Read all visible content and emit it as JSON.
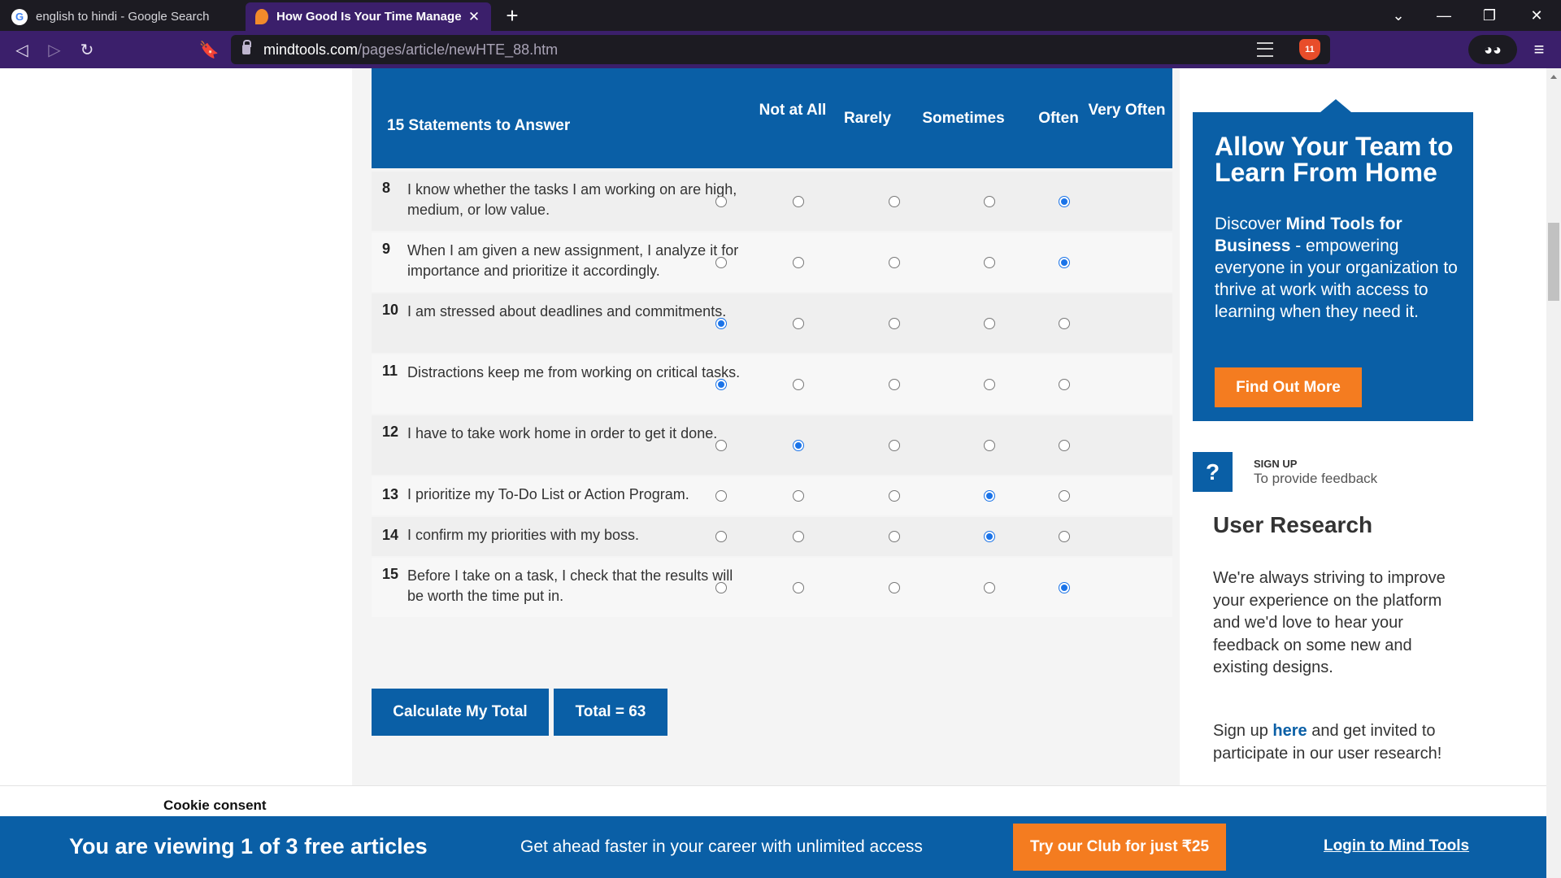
{
  "browser": {
    "tabs": [
      {
        "title": "english to hindi - Google Search",
        "active": false
      },
      {
        "title": "How Good Is Your Time Management",
        "active": true
      }
    ],
    "url_host": "mindtools.com",
    "url_path": "/pages/article/newHTE_88.htm",
    "brave_shield_count": "11"
  },
  "quiz": {
    "header_title": "15 Statements to Answer",
    "columns": [
      "Not at All",
      "Rarely",
      "Sometimes",
      "Often",
      "Very Often"
    ],
    "rows": [
      {
        "num": "8",
        "text": "I know whether the tasks I am working on are high, medium, or low value.",
        "selected": "Very Often"
      },
      {
        "num": "9",
        "text": "When I am given a new assignment, I analyze it for importance and prioritize it accordingly.",
        "selected": "Very Often"
      },
      {
        "num": "10",
        "text": "I am stressed about deadlines and commitments.",
        "selected": "Not at All"
      },
      {
        "num": "11",
        "text": "Distractions keep me from working on critical tasks.",
        "selected": "Not at All"
      },
      {
        "num": "12",
        "text": "I have to take work home in order to get it done.",
        "selected": "Rarely"
      },
      {
        "num": "13",
        "text": "I prioritize my To-Do List or Action Program.",
        "selected": "Often"
      },
      {
        "num": "14",
        "text": "I confirm my priorities with my boss.",
        "selected": "Often"
      },
      {
        "num": "15",
        "text": "Before I take on a task, I check that the results will be worth the time put in.",
        "selected": "Very Often"
      }
    ],
    "calc_button": "Calculate My Total",
    "total_label": "Total = 63"
  },
  "promo": {
    "title": "Allow Your Team to Learn From Home",
    "body_pre": "Discover ",
    "body_bold": "Mind Tools for Business",
    "body_post": " - empowering everyone in your organization to thrive at work with access to learning when they need it.",
    "button": "Find Out More"
  },
  "research": {
    "icon": "question-icon",
    "icon_glyph": "?",
    "signup_label": "SIGN UP",
    "signup_sub": "To provide feedback",
    "title": "User Research",
    "body": "We're always striving to improve your experience on the platform and we'd love to hear your feedback on some new and existing designs.",
    "signup_pre": "Sign up ",
    "signup_link": "here",
    "signup_post": " and get invited to participate in our user research!"
  },
  "cookie": {
    "label": "Cookie consent"
  },
  "banner": {
    "main": "You are viewing 1 of 3 free articles",
    "sub": "Get ahead faster in your career with unlimited access",
    "button": "Try our Club for just ₹25",
    "login": "Login to Mind Tools"
  },
  "colors": {
    "brand_blue": "#0a5fa6",
    "accent_orange": "#f47c20",
    "browser_purple": "#3b1f6b"
  }
}
